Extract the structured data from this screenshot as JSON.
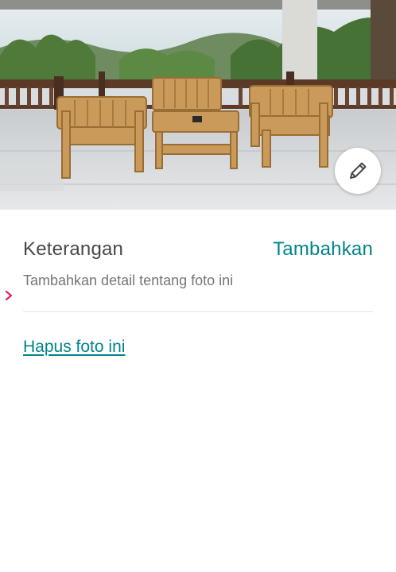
{
  "photo": {
    "alt_name": "bamboo-furniture-veranda-photo"
  },
  "edit_button": {
    "icon": "pencil-icon"
  },
  "caption": {
    "label": "Keterangan",
    "add_action": "Tambahkan",
    "hint": "Tambahkan detail tentang foto ini"
  },
  "actions": {
    "delete_label": "Hapus foto ini"
  },
  "colors": {
    "accent": "#008489",
    "text_primary": "#484848",
    "text_secondary": "#767676",
    "divider": "#e4e4e4",
    "chevron": "#e0245e"
  }
}
